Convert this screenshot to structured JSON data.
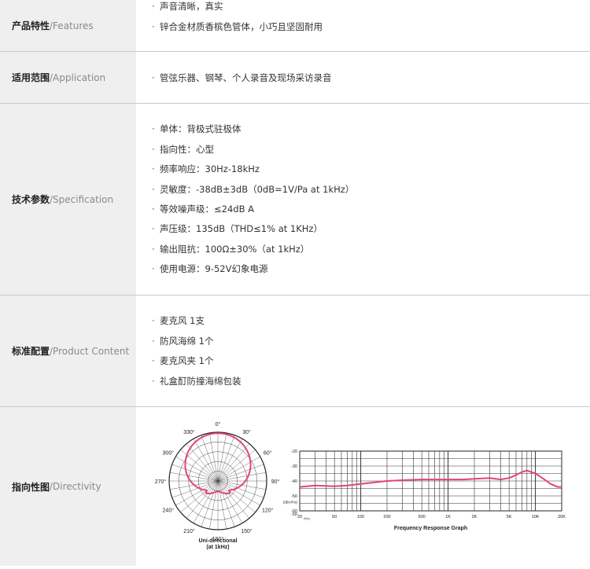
{
  "features": {
    "label_zh": "产品特性",
    "label_en": "/Features",
    "items": [
      "声音清晰，真实",
      "锌合金材质香槟色管体，小巧且坚固耐用"
    ]
  },
  "application": {
    "label_zh": "适用范围",
    "label_en": "/Application",
    "items": [
      "管弦乐器、钢琴、个人录音及现场采访录音"
    ]
  },
  "specification": {
    "label_zh": "技术参数",
    "label_en": "/Specification",
    "items": [
      "单体：背极式驻极体",
      "指向性：心型",
      "频率响应：30Hz-18kHz",
      "灵敏度：-38dB±3dB（0dB=1V/Pa at 1kHz）",
      "等效噪声级：≤24dB A",
      "声压级：135dB（THD≤1% at 1KHz）",
      "输出阻抗：100Ω±30%（at 1kHz）",
      "使用电源：9-52V幻象电源"
    ]
  },
  "content": {
    "label_zh": "标准配置",
    "label_en": "/Product Content",
    "items": [
      "麦克风 1支",
      "防风海绵 1个",
      "麦克风夹 1个",
      "礼盒酊防撞海绵包装"
    ]
  },
  "directivity": {
    "label_zh": "指向性图",
    "label_en": "/Directivity",
    "polar": {
      "angle_labels": [
        "0°",
        "30°",
        "60°",
        "90°",
        "120°",
        "150°",
        "180°",
        "210°",
        "240°",
        "270°",
        "300°",
        "330°"
      ],
      "caption_line1": "Uni-directional",
      "caption_line2": "(at 1kHz)",
      "curve_color": "#e0457b"
    },
    "response": {
      "y_ticks": [
        "-20",
        "-30",
        "-40",
        "-50",
        "-60",
        "-50"
      ],
      "y_unit": "(dBV/Pa)",
      "x_ticks": [
        "20",
        "50",
        "100",
        "200",
        "500",
        "1K",
        "2K",
        "5K",
        "10K",
        "20K"
      ],
      "x_unit": "(Hz)",
      "caption": "Frequency Response Graph",
      "curve_color": "#e0457b"
    }
  },
  "chart_data": {
    "type": "line",
    "title": "Frequency Response Graph",
    "xlabel": "(Hz)",
    "ylabel": "(dBV/Pa)",
    "x": [
      20,
      30,
      50,
      70,
      100,
      200,
      300,
      500,
      700,
      1000,
      1500,
      2000,
      3000,
      4000,
      5000,
      6000,
      7000,
      8000,
      10000,
      12000,
      15000,
      18000,
      20000
    ],
    "series": [
      {
        "values": [
          -44,
          -43,
          -43.5,
          -43,
          -42,
          -40,
          -39.5,
          -39,
          -39,
          -39,
          -39,
          -38.5,
          -38,
          -39,
          -38,
          -36,
          -34,
          -33,
          -35,
          -38,
          -42,
          -44,
          -44
        ]
      }
    ],
    "ylim": [
      -60,
      -20
    ]
  }
}
